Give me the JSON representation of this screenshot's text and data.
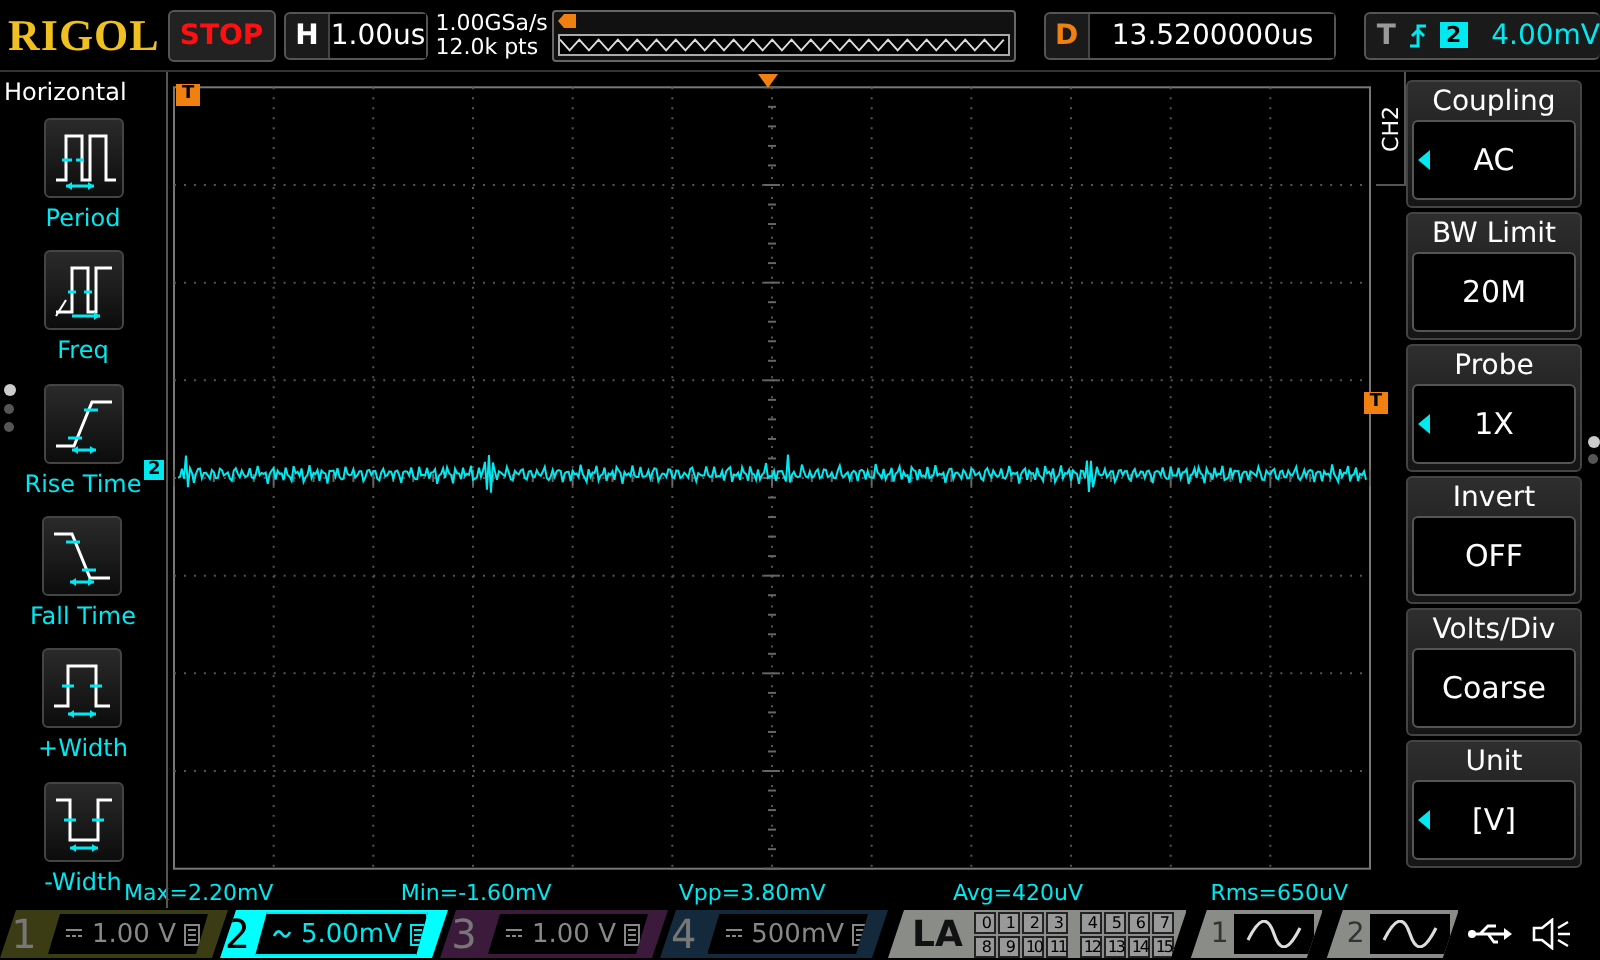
{
  "header": {
    "logo": "RIGOL",
    "run_state": "STOP",
    "timebase": {
      "label": "H",
      "value": "1.00us"
    },
    "sample_rate": "1.00GSa/s",
    "memory_depth": "12.0k pts",
    "delay": {
      "label": "D",
      "value": "13.5200000us"
    },
    "trigger": {
      "label": "T",
      "channel": "2",
      "level": "4.00mV"
    }
  },
  "left_menu": {
    "title": "Horizontal",
    "pages": [
      {
        "selected": true
      },
      {
        "selected": false
      },
      {
        "selected": false
      }
    ],
    "items": [
      {
        "label": "Period",
        "kind": "period"
      },
      {
        "label": "Freq",
        "kind": "freq"
      },
      {
        "label": "Rise Time",
        "kind": "rise"
      },
      {
        "label": "Fall Time",
        "kind": "fall"
      },
      {
        "label": "+Width",
        "kind": "pwidth"
      },
      {
        "label": "-Width",
        "kind": "nwidth"
      }
    ]
  },
  "waveform": {
    "time_marker": "T",
    "channel_marker": "2",
    "trigger_level_marker": "T"
  },
  "measurements": [
    "Max=2.20mV",
    "Min=-1.60mV",
    "Vpp=3.80mV",
    "Avg=420uV",
    "Rms=650uV"
  ],
  "side_menu": {
    "channel_tab": "CH2",
    "pages": [
      {
        "selected": true
      },
      {
        "selected": false
      }
    ],
    "items": [
      {
        "title": "Coupling",
        "value": "AC",
        "has_arrow": true
      },
      {
        "title": "BW Limit",
        "value": "20M",
        "has_arrow": false
      },
      {
        "title": "Probe",
        "value": "1X",
        "has_arrow": true
      },
      {
        "title": "Invert",
        "value": "OFF",
        "has_arrow": false
      },
      {
        "title": "Volts/Div",
        "value": "Coarse",
        "has_arrow": false
      },
      {
        "title": "Unit",
        "value": "[V]",
        "has_arrow": true
      }
    ]
  },
  "channels": [
    {
      "number": "1",
      "kind": "dc",
      "scale": "1.00 V",
      "active": false,
      "color": "#3c3c14"
    },
    {
      "number": "2",
      "kind": "ac",
      "scale": "5.00mV",
      "active": true,
      "color": "#00ffff"
    },
    {
      "number": "3",
      "kind": "dc",
      "scale": "1.00 V",
      "active": false,
      "color": "#3c1a3c"
    },
    {
      "number": "4",
      "kind": "dc",
      "scale": "500mV",
      "active": false,
      "color": "#142a3c"
    }
  ],
  "logic_analyzer": {
    "label": "LA",
    "bits": [
      [
        "0",
        "1",
        "2",
        "3",
        "4",
        "5",
        "6",
        "7"
      ],
      [
        "8",
        "9",
        "10",
        "11",
        "12",
        "13",
        "14",
        "15"
      ]
    ]
  },
  "generators": [
    {
      "number": "1"
    },
    {
      "number": "2"
    }
  ]
}
